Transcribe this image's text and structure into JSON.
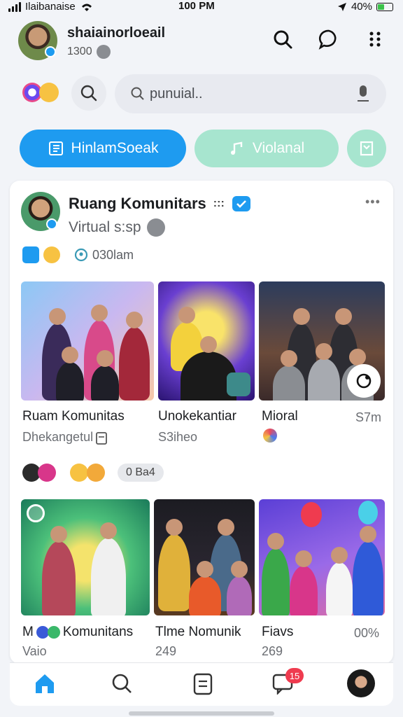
{
  "status_bar": {
    "carrier": "Ilaibanaise",
    "time": "100 PM",
    "battery": "40%"
  },
  "header": {
    "title": "shaiainorloeail",
    "subtitle": "1300"
  },
  "search": {
    "placeholder": "punuial.."
  },
  "buttons": {
    "primary_label": "HinlamSoeak",
    "secondary_label": "Violanal"
  },
  "card": {
    "title": "Ruang Komunitars",
    "title_dots": ":::",
    "subtitle": "Virtual s:sp",
    "meta_time": "030lam"
  },
  "posts_row1": [
    {
      "title": "Ruam Komunitas",
      "subtitle": "Dhekangetul"
    },
    {
      "title": "Unokekantiar",
      "subtitle": "S3iheo"
    },
    {
      "title": "Mioral",
      "right_value": "S7m"
    }
  ],
  "reactions_row": {
    "count": "0 Ba4"
  },
  "posts_row2": [
    {
      "title": "Komunitans",
      "title_prefix": "M",
      "subtitle": "Vaio"
    },
    {
      "title": "Tlme Nomunik",
      "subtitle": "249"
    },
    {
      "title": "Fiavs",
      "subtitle": "269",
      "right_value": "00%"
    }
  ],
  "tab_bar": {
    "chat_badge": "15"
  },
  "colors": {
    "accent": "#1e9bf0",
    "mint": "#a7e5cf",
    "badge": "#ef3b4f"
  }
}
